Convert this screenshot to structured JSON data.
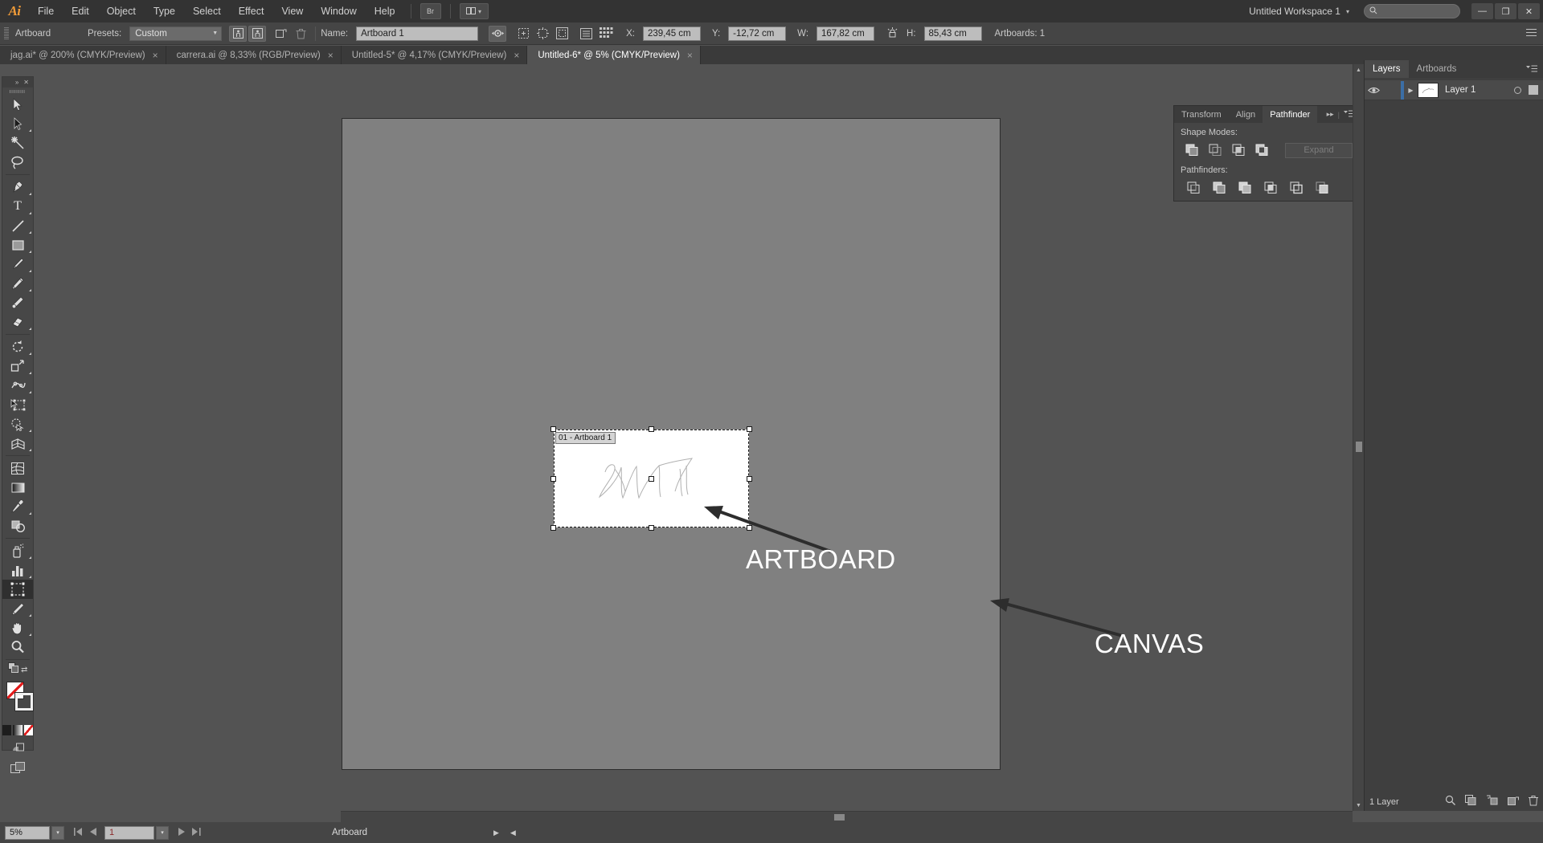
{
  "app": {
    "name": "Adobe Illustrator",
    "logo_text": "Ai",
    "workspace": "Untitled Workspace 1",
    "search_placeholder": ""
  },
  "menubar": {
    "items": [
      {
        "label": "File"
      },
      {
        "label": "Edit"
      },
      {
        "label": "Object"
      },
      {
        "label": "Type"
      },
      {
        "label": "Select"
      },
      {
        "label": "Effect"
      },
      {
        "label": "View"
      },
      {
        "label": "Window"
      },
      {
        "label": "Help"
      }
    ],
    "bridge_label": "Br",
    "arrange_label": "",
    "window_controls": {
      "minimize": "—",
      "restore": "❐",
      "close": "✕"
    }
  },
  "controlbar": {
    "tool_name": "Artboard",
    "presets_label": "Presets:",
    "presets_value": "Custom",
    "name_label": "Name:",
    "name_value": "Artboard 1",
    "x_label": "X:",
    "x_value": "239,45 cm",
    "y_label": "Y:",
    "y_value": "-12,72 cm",
    "w_label": "W:",
    "w_value": "167,82 cm",
    "h_label": "H:",
    "h_value": "85,43 cm",
    "artboards_label": "Artboards: 1",
    "icons": [
      "new-artboard-portrait-icon",
      "new-artboard-landscape-icon",
      "duplicate-artboard-icon",
      "delete-artboard-icon",
      "move-artwork-icon",
      "show-center-mark-icon",
      "show-cross-hairs-icon",
      "show-video-safe-icon",
      "artboard-options-icon",
      "rearrange-artboards-icon"
    ]
  },
  "tabs": [
    {
      "label": "jag.ai* @ 200% (CMYK/Preview)",
      "active": false,
      "close": "×"
    },
    {
      "label": "carrera.ai @ 8,33% (RGB/Preview)",
      "active": false,
      "close": "×"
    },
    {
      "label": "Untitled-5* @ 4,17% (CMYK/Preview)",
      "active": false,
      "close": "×"
    },
    {
      "label": "Untitled-6* @ 5% (CMYK/Preview)",
      "active": true,
      "close": "×"
    }
  ],
  "toolbar": {
    "collapse_icon": "»",
    "close_icon": "✕",
    "tools": [
      {
        "name": "selection-tool",
        "group": 1,
        "flyout": false,
        "selected": false
      },
      {
        "name": "direct-selection-tool",
        "group": 1,
        "flyout": true,
        "selected": false
      },
      {
        "name": "magic-wand-tool",
        "group": 1,
        "flyout": false,
        "selected": false
      },
      {
        "name": "lasso-tool",
        "group": 1,
        "flyout": false,
        "selected": false
      },
      {
        "name": "pen-tool",
        "group": 2,
        "flyout": true,
        "selected": false
      },
      {
        "name": "type-tool",
        "group": 2,
        "flyout": true,
        "selected": false
      },
      {
        "name": "line-segment-tool",
        "group": 2,
        "flyout": true,
        "selected": false
      },
      {
        "name": "rectangle-tool",
        "group": 2,
        "flyout": true,
        "selected": false
      },
      {
        "name": "paintbrush-tool",
        "group": 2,
        "flyout": true,
        "selected": false
      },
      {
        "name": "pencil-tool",
        "group": 2,
        "flyout": true,
        "selected": false
      },
      {
        "name": "blob-brush-tool",
        "group": 2,
        "flyout": false,
        "selected": false
      },
      {
        "name": "eraser-tool",
        "group": 2,
        "flyout": true,
        "selected": false
      },
      {
        "name": "rotate-tool",
        "group": 3,
        "flyout": true,
        "selected": false
      },
      {
        "name": "scale-tool",
        "group": 3,
        "flyout": true,
        "selected": false
      },
      {
        "name": "width-tool",
        "group": 3,
        "flyout": true,
        "selected": false
      },
      {
        "name": "free-transform-tool",
        "group": 3,
        "flyout": false,
        "selected": false
      },
      {
        "name": "shape-builder-tool",
        "group": 3,
        "flyout": true,
        "selected": false
      },
      {
        "name": "perspective-grid-tool",
        "group": 3,
        "flyout": true,
        "selected": false
      },
      {
        "name": "mesh-tool",
        "group": 4,
        "flyout": false,
        "selected": false
      },
      {
        "name": "gradient-tool",
        "group": 4,
        "flyout": false,
        "selected": false
      },
      {
        "name": "eyedropper-tool",
        "group": 4,
        "flyout": true,
        "selected": false
      },
      {
        "name": "blend-tool",
        "group": 4,
        "flyout": false,
        "selected": false
      },
      {
        "name": "symbol-sprayer-tool",
        "group": 5,
        "flyout": true,
        "selected": false
      },
      {
        "name": "column-graph-tool",
        "group": 5,
        "flyout": true,
        "selected": false
      },
      {
        "name": "artboard-tool",
        "group": 5,
        "flyout": false,
        "selected": true
      },
      {
        "name": "slice-tool",
        "group": 5,
        "flyout": true,
        "selected": false
      },
      {
        "name": "hand-tool",
        "group": 6,
        "flyout": true,
        "selected": false
      },
      {
        "name": "zoom-tool",
        "group": 6,
        "flyout": false,
        "selected": false
      }
    ],
    "bottom": {
      "fill_stroke_name": "fill-and-stroke-swatches",
      "default_colors_icon": "default-fill-stroke-icon",
      "swap_icon": "⇄",
      "color_mode_none": "none-color-icon",
      "color_mode_gradient": "gradient-color-icon",
      "color_mode_color": "color-icon",
      "drawing_mode_icon": "draw-normal-icon",
      "screen_mode_icon": "change-screen-mode-icon"
    }
  },
  "canvas": {
    "artboard_label": "01 - Artboard 1",
    "annotations": [
      {
        "name": "artboard-annotation",
        "text": "ARTBOARD"
      },
      {
        "name": "canvas-annotation",
        "text": "CANVAS"
      }
    ]
  },
  "pathfinder_panel": {
    "tabs": [
      {
        "label": "Transform",
        "active": false
      },
      {
        "label": "Align",
        "active": false
      },
      {
        "label": "Pathfinder",
        "active": true
      }
    ],
    "collapse_icon": "▸▸",
    "menu_icon": "≡",
    "shape_modes_label": "Shape Modes:",
    "shape_modes": [
      {
        "name": "unite-button"
      },
      {
        "name": "minus-front-button"
      },
      {
        "name": "intersect-button"
      },
      {
        "name": "exclude-button"
      }
    ],
    "expand_label": "Expand",
    "pathfinders_label": "Pathfinders:",
    "pathfinders": [
      {
        "name": "divide-button"
      },
      {
        "name": "trim-button"
      },
      {
        "name": "merge-button"
      },
      {
        "name": "crop-button"
      },
      {
        "name": "outline-button"
      },
      {
        "name": "minus-back-button"
      }
    ]
  },
  "dock": {
    "collapse_icon": "▸▸",
    "close_icon": "✕",
    "items": [
      {
        "label": "Transform",
        "icon": "transform-icon",
        "active": false
      },
      {
        "label": "Align",
        "icon": "align-icon",
        "active": false
      },
      {
        "label": "Pathfinder",
        "icon": "pathfinder-icon",
        "active": true
      }
    ]
  },
  "layers_panel": {
    "tabs": [
      {
        "label": "Layers",
        "active": true
      },
      {
        "label": "Artboards",
        "active": false
      }
    ],
    "menu_icon": "≡",
    "rows": [
      {
        "name": "Layer 1",
        "visible": true,
        "locked": false,
        "selected": true,
        "color": "#3b6ea5"
      }
    ],
    "footer": {
      "count_label": "1 Layer",
      "icons": [
        {
          "name": "locate-object-icon"
        },
        {
          "name": "make-clipping-mask-icon"
        },
        {
          "name": "create-new-sublayer-icon"
        },
        {
          "name": "create-new-layer-icon"
        },
        {
          "name": "delete-selection-icon"
        }
      ]
    }
  },
  "statusbar": {
    "zoom_value": "5%",
    "zoom_caret": "▾",
    "page_value": "1",
    "page_caret": "▾",
    "status_text": "Artboard",
    "first_icon": "⏮",
    "prev_icon": "◀",
    "next_icon": "▶",
    "last_icon": "⏭",
    "expand_icon": "▶",
    "collapse_icon": "◀"
  }
}
